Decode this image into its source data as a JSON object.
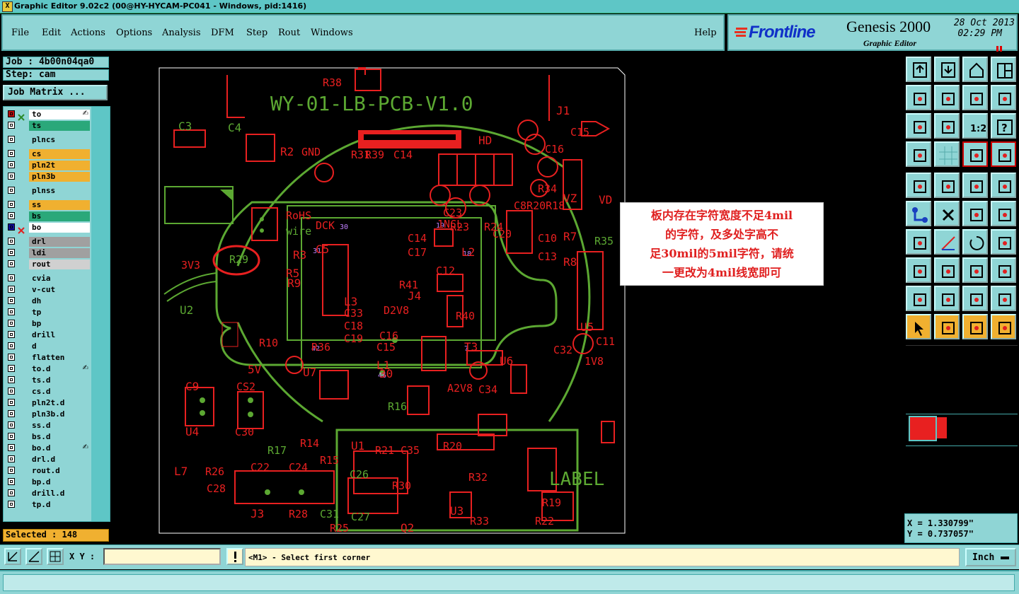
{
  "window": {
    "title": "Graphic Editor 9.02c2 (00@HY-HYCAM-PC041 - Windows, pid:1416)"
  },
  "menu": {
    "items": [
      "File",
      "Edit",
      "Actions",
      "Options",
      "Analysis",
      "DFM",
      "Step",
      "Rout",
      "Windows"
    ],
    "help": "Help"
  },
  "brand": {
    "logo": "Frontline",
    "product": "Genesis 2000",
    "subtitle": "Graphic Editor",
    "date": "28 Oct 2013",
    "time": "02:29 PM"
  },
  "job": {
    "job_label": "Job : 4b00n04qa0",
    "step_label": "Step: cam",
    "matrix_button": "Job Matrix ..."
  },
  "layers": [
    {
      "name": "to",
      "color": "#ffffff",
      "edit": true
    },
    {
      "name": "ts",
      "color": "#2aa87a"
    },
    {
      "name": "plncs",
      "color": "#8fd5d5"
    },
    {
      "name": "cs",
      "color": "#f0b030"
    },
    {
      "name": "pln2t",
      "color": "#f0b030"
    },
    {
      "name": "pln3b",
      "color": "#f0b030"
    },
    {
      "name": "plnss",
      "color": "#8fd5d5"
    },
    {
      "name": "ss",
      "color": "#f0b030"
    },
    {
      "name": "bs",
      "color": "#2aa87a"
    },
    {
      "name": "bo",
      "color": "#ffffff",
      "work": true
    },
    {
      "name": "drl",
      "color": "#a0a0a0"
    },
    {
      "name": "ldi",
      "color": "#a0a0a0"
    },
    {
      "name": "rout",
      "color": "#d0d0d0"
    },
    {
      "name": "cvia",
      "color": "#8fd5d5"
    },
    {
      "name": "v-cut",
      "color": "#8fd5d5"
    },
    {
      "name": "dh",
      "color": "#8fd5d5"
    },
    {
      "name": "tp",
      "color": "#8fd5d5"
    },
    {
      "name": "bp",
      "color": "#8fd5d5"
    },
    {
      "name": "drill",
      "color": "#8fd5d5"
    },
    {
      "name": "d",
      "color": "#8fd5d5"
    },
    {
      "name": "flatten",
      "color": "#8fd5d5"
    },
    {
      "name": "to.d",
      "color": "#8fd5d5",
      "edit": true
    },
    {
      "name": "ts.d",
      "color": "#8fd5d5"
    },
    {
      "name": "cs.d",
      "color": "#8fd5d5"
    },
    {
      "name": "pln2t.d",
      "color": "#8fd5d5"
    },
    {
      "name": "pln3b.d",
      "color": "#8fd5d5"
    },
    {
      "name": "ss.d",
      "color": "#8fd5d5"
    },
    {
      "name": "bs.d",
      "color": "#8fd5d5"
    },
    {
      "name": "bo.d",
      "color": "#8fd5d5",
      "edit": true
    },
    {
      "name": "drl.d",
      "color": "#8fd5d5"
    },
    {
      "name": "rout.d",
      "color": "#8fd5d5"
    },
    {
      "name": "bp.d",
      "color": "#8fd5d5"
    },
    {
      "name": "drill.d",
      "color": "#8fd5d5"
    },
    {
      "name": "tp.d",
      "color": "#8fd5d5"
    }
  ],
  "selected": "Selected : 148",
  "callout": {
    "lines": [
      "板内存在字符宽度不足4mil",
      "的字符，及多处字高不",
      "足30mil的5mil字符，请统",
      "一更改为4mil线宽即可"
    ]
  },
  "pcb": {
    "title": "WY-01-LB-PCB-V1.0",
    "labels": [
      "R38",
      "J1",
      "C3",
      "C4",
      "R2",
      "GND",
      "R31",
      "R39",
      "C14",
      "C15",
      "C16",
      "R34",
      "VZ",
      "3V3",
      "R29",
      "U2",
      "RoHS",
      "wire",
      "R3",
      "R5",
      "R9",
      "C14",
      "C17",
      "C12",
      "C10",
      "C13",
      "R8",
      "R7",
      "R35",
      "R41",
      "J4",
      "D2V8",
      "L3",
      "C33",
      "C18",
      "C19",
      "C16",
      "C15",
      "R40",
      "U5",
      "C11",
      "1V8",
      "R10",
      "5V",
      "U7",
      "L1",
      "A2V8",
      "C34",
      "U6",
      "C32",
      "C9",
      "U4",
      "CS2",
      "C30",
      "R16",
      "R17",
      "R14",
      "R15",
      "U1",
      "R21",
      "C35",
      "R20",
      "L7",
      "R26",
      "C28",
      "C22",
      "C24",
      "J3",
      "R28",
      "C31",
      "C27",
      "C26",
      "R30",
      "R32",
      "U3",
      "R33",
      "R22",
      "LABEL",
      "R19",
      "Q2",
      "R25",
      "C23",
      "R23",
      "R24",
      "C20",
      "C8R20R18",
      "HD",
      "VD",
      "DCK",
      "1NCL",
      "C5",
      "L2",
      "R36",
      "T3",
      "30",
      "19",
      "31",
      "18",
      "42",
      "7",
      "46"
    ]
  },
  "toolbox_icons": [
    "zoom-home-icon",
    "zoom-fit-icon",
    "home-view-icon",
    "window-split-icon",
    "pan-left-icon",
    "pan-right-icon",
    "redo-view-icon",
    "swap-icon",
    "fit-all-icon",
    "center-icon",
    "scale-1-2-icon",
    "help-question-icon",
    "tools-icon",
    "grid-icon",
    "layers-left-icon",
    "layers-right-icon",
    "pad-icon",
    "shape-icon",
    "ruler-icon",
    "snap-icon",
    "connect-icon",
    "cross-icon",
    "angle-icon",
    "arrow-node-icon",
    "draw-angle-icon",
    "line-icon",
    "rotate-icon",
    "mirror-icon",
    "measure-icon",
    "split-icon",
    "resize-icon",
    "group-icon",
    "triangle-a-icon",
    "triangle-b-icon",
    "triangle-c-icon",
    "triangle-d-icon",
    "select-pointer-icon",
    "select-box-icon",
    "select-area-icon",
    "select-net-icon"
  ],
  "coords": {
    "x": "X = 1.330799\"",
    "y": "Y = 0.737057\""
  },
  "bottom": {
    "xy_label": "X Y :",
    "xy_value": "",
    "prompt": "<M1> - Select first corner",
    "units": "Inch"
  },
  "colors": {
    "panel": "#8fd5d5",
    "silk_red": "#e82020",
    "outline_green": "#5ca832",
    "accent_orange": "#f0b030"
  }
}
